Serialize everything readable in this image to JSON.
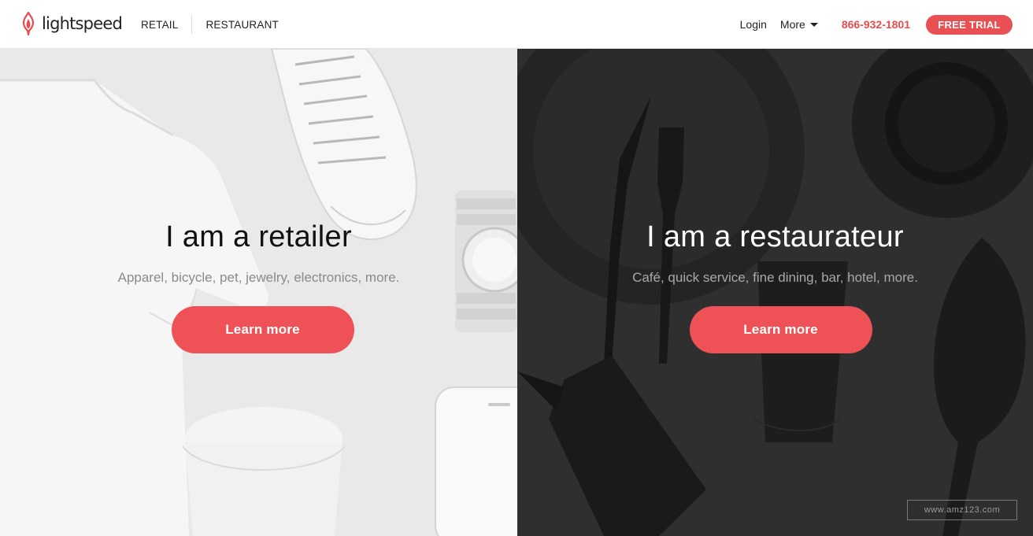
{
  "header": {
    "logo_text": "lightspeed",
    "nav_left": [
      "RETAIL",
      "RESTAURANT"
    ],
    "login": "Login",
    "more": "More",
    "phone": "866-932-1801",
    "trial": "FREE TRIAL"
  },
  "retail": {
    "title": "I am a retailer",
    "subtitle": "Apparel, bicycle, pet, jewelry, electronics, more.",
    "cta": "Learn more"
  },
  "restaurant": {
    "title": "I am a restaurateur",
    "subtitle": "Café, quick service, fine dining, bar, hotel, more.",
    "cta": "Learn more"
  },
  "watermark": "www.amz123.com",
  "colors": {
    "accent": "#ee5256",
    "phone": "#e84c4f",
    "retail_bg": "#e9e9e9",
    "restaurant_bg": "#2f2f2f"
  },
  "icons": [
    "flame-logo-icon",
    "caret-down-icon"
  ]
}
